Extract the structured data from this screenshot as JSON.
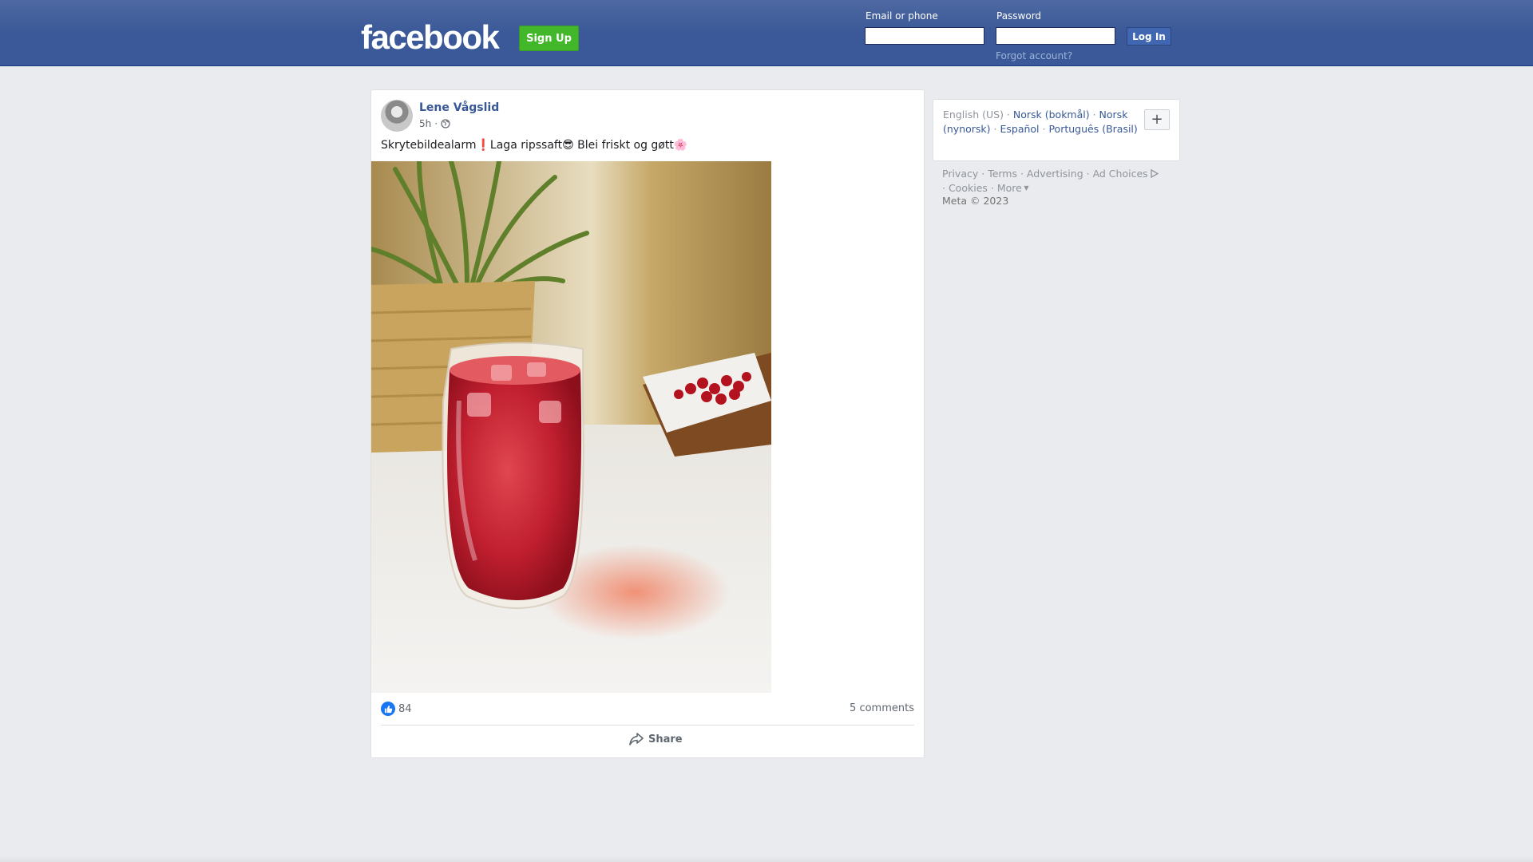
{
  "header": {
    "logo": "facebook",
    "signup_label": "Sign Up",
    "email_label": "Email or phone",
    "email_value": "",
    "password_label": "Password",
    "password_value": "",
    "login_label": "Log In",
    "forgot_label": "Forgot account?"
  },
  "post": {
    "author": "Lene Vågslid",
    "time": "5h",
    "separator": "·",
    "privacy_icon": "globe-icon",
    "text": "Skrytebildealarm❗Laga ripssaft😎 Blei friskt og gøtt🌸",
    "photo_icon": "photo-drink-glass",
    "like_count": "84",
    "comments": "5 comments",
    "share_label": "Share"
  },
  "languages": {
    "current": "English (US)",
    "items": [
      "Norsk (bokmål)",
      "Norsk (nynorsk)",
      "Español",
      "Português (Brasil)"
    ],
    "more_label": "+"
  },
  "footer": {
    "links": [
      "Privacy",
      "Terms",
      "Advertising",
      "Ad Choices",
      "Cookies",
      "More"
    ],
    "copyright": "Meta © 2023"
  },
  "colors": {
    "header": "#3b5998",
    "signup": "#42b72a",
    "link": "#385898",
    "like": "#1877f2"
  }
}
